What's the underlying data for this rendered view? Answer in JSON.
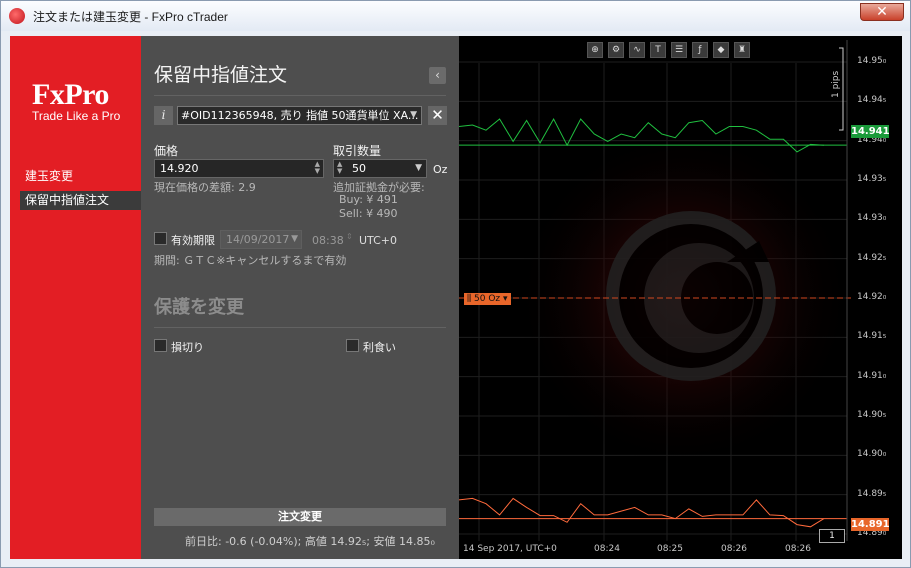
{
  "window": {
    "title": "注文または建玉変更 - FxPro cTrader",
    "close_label": "✕"
  },
  "sidebar": {
    "logo": "FxPro",
    "tagline": "Trade Like a Pro",
    "items": [
      {
        "label": "建玉変更"
      },
      {
        "label": "保留中指値注文"
      }
    ]
  },
  "form": {
    "title": "保留中指値注文",
    "back_label": "‹",
    "info_label": "i",
    "order_select": "#OID112365948, 売り 指値 50通貨単位 XA...",
    "clear_label": "✕",
    "price": {
      "label": "価格",
      "value": "14.920",
      "diff": "現在価格の差額: 2.9"
    },
    "quantity": {
      "label": "取引数量",
      "value": "50",
      "unit": "Oz",
      "margin_label": "追加証拠金が必要:",
      "buy": "Buy: ¥ 491",
      "sell": "Sell: ¥ 490"
    },
    "expiry": {
      "label": "有効期限",
      "date": "14/09/2017",
      "time": "08:38",
      "tz": "UTC+0",
      "note": "期間: ＧＴＣ※キャンセルするまで有効"
    },
    "protection": {
      "title": "保護を変更",
      "stop_loss": "損切り",
      "take_profit": "利食い"
    },
    "submit_label": "注文変更",
    "stats": "前日比: -0.6 (-0.04%); 高値 14.92₅; 安値 14.85₀"
  },
  "chart": {
    "toolbar": [
      "zoom-in-icon",
      "settings-icon",
      "chart-type-icon",
      "period-icon",
      "list-icon",
      "trend-icon",
      "shapes-icon",
      "pattern-icon"
    ],
    "toolbar_glyphs": [
      "⊕",
      "⚙",
      "∿",
      "T",
      "☰",
      "ƒ",
      "◆",
      "♜"
    ],
    "axis_labels": [
      "14.95₀",
      "14.94₅",
      "14.94₀",
      "14.93₅",
      "14.93₀",
      "14.92₅",
      "14.92₀",
      "14.91₅",
      "14.91₀",
      "14.90₅",
      "14.90₀",
      "14.89₅",
      "14.89₀"
    ],
    "time_labels": [
      "14 Sep 2017, UTC+0",
      "08:24",
      "08:25",
      "08:26",
      "08:26"
    ],
    "ask_tag": "14.941",
    "bid_tag": "14.891",
    "position_tag": "⫼ 50 Oz ▾",
    "pips_label": "1 pips",
    "count": "1",
    "colors": {
      "ask": "#20c040",
      "bid": "#ff6a3c",
      "order_line": "#d04820",
      "ask_tag": "#1a9a3a",
      "bid_tag": "#e8662a"
    },
    "chart_data": {
      "type": "line",
      "ylim": [
        14.888,
        14.952
      ],
      "series": [
        {
          "values": [
            14.9435,
            14.9437,
            14.943,
            14.9445,
            14.9415,
            14.9443,
            14.9413,
            14.9445,
            14.941,
            14.9445,
            14.9425,
            14.9415,
            14.9425,
            14.942,
            14.944,
            14.9425,
            14.942,
            14.944,
            14.9443,
            14.9425,
            14.9435,
            14.9435,
            14.943,
            14.9418,
            14.9418,
            14.9401,
            14.9411,
            14.941
          ]
        },
        {
          "values": [
            14.8935,
            14.8937,
            14.893,
            14.8915,
            14.8937,
            14.8925,
            14.8914,
            14.8914,
            14.8905,
            14.893,
            14.8915,
            14.8915,
            14.892,
            14.8925,
            14.8915,
            14.8915,
            14.891,
            14.8923,
            14.8913,
            14.8915,
            14.8915,
            14.8915,
            14.8935,
            14.8915,
            14.8914,
            14.8902,
            14.8899,
            14.891
          ]
        }
      ]
    }
  }
}
